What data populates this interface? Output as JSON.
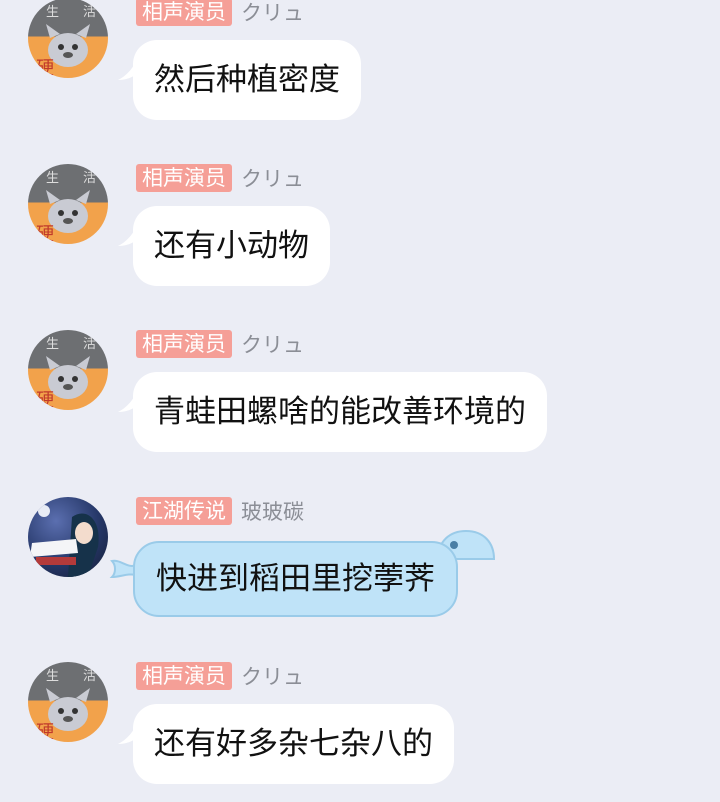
{
  "messages": [
    {
      "title": "相声演员",
      "nickname": "クリュ",
      "text": "然后种植密度",
      "avatar": "cat-avatar"
    },
    {
      "title": "相声演员",
      "nickname": "クリュ",
      "text": "还有小动物",
      "avatar": "cat-avatar"
    },
    {
      "title": "相声演员",
      "nickname": "クリュ",
      "text": "青蛙田螺啥的能改善环境的",
      "avatar": "cat-avatar"
    },
    {
      "title": "江湖传说",
      "nickname": "玻玻碳",
      "text": "快进到稻田里挖荸荠",
      "avatar": "anime-avatar",
      "bubble_style": "blue-whale"
    },
    {
      "title": "相声演员",
      "nickname": "クリュ",
      "text": "还有好多杂七杂八的",
      "avatar": "cat-avatar"
    }
  ],
  "avatar_text": {
    "top_left": "生",
    "top_right": "活",
    "bottom": "硬"
  },
  "colors": {
    "background": "#ebedf5",
    "badge": "#f59f97",
    "bubble": "#ffffff",
    "blue_bubble": "#bfe3f8",
    "nickname": "#8b8e96"
  }
}
